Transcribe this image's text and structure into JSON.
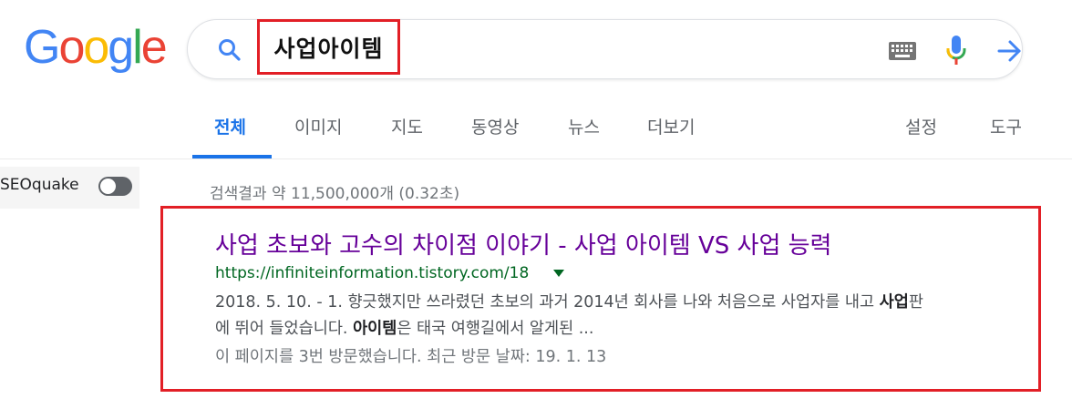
{
  "logo": {
    "letters": [
      {
        "ch": "G",
        "color": "#4285F4"
      },
      {
        "ch": "o",
        "color": "#EA4335"
      },
      {
        "ch": "o",
        "color": "#FBBC05"
      },
      {
        "ch": "g",
        "color": "#4285F4"
      },
      {
        "ch": "l",
        "color": "#34A853"
      },
      {
        "ch": "e",
        "color": "#EA4335"
      }
    ]
  },
  "search": {
    "query": "사업아이템"
  },
  "tabs": {
    "all": "전체",
    "images": "이미지",
    "maps": "지도",
    "videos": "동영상",
    "news": "뉴스",
    "more": "더보기",
    "settings": "설정",
    "tools": "도구"
  },
  "seoquake": {
    "label": "SEOquake"
  },
  "stats": "검색결과 약 11,500,000개 (0.32초)",
  "result": {
    "title": "사업 초보와 고수의 차이점 이야기 - 사업 아이템 VS 사업 능력",
    "url": "https://infiniteinformation.tistory.com/18",
    "snippet_line1_pre": "2018. 5. 10. - 1. 향긋했지만 쓰라렸던 초보의 과거 2014년 회사를 나와 처음으로 사업자를 내고 ",
    "snippet_line1_bold": "사업",
    "snippet_line1_post": "판",
    "snippet_line2_pre": "에 뛰어 들었습니다. ",
    "snippet_line2_bold": "아이템",
    "snippet_line2_post": "은 태국 여행길에서 알게된 ...",
    "visit_note": "이 페이지를 3번 방문했습니다. 최근 방문 날짜: 19. 1. 13"
  },
  "colors": {
    "accent": "#1a73e8",
    "highlight": "#e21f26",
    "visited_link": "#660099",
    "url_green": "#006621"
  }
}
